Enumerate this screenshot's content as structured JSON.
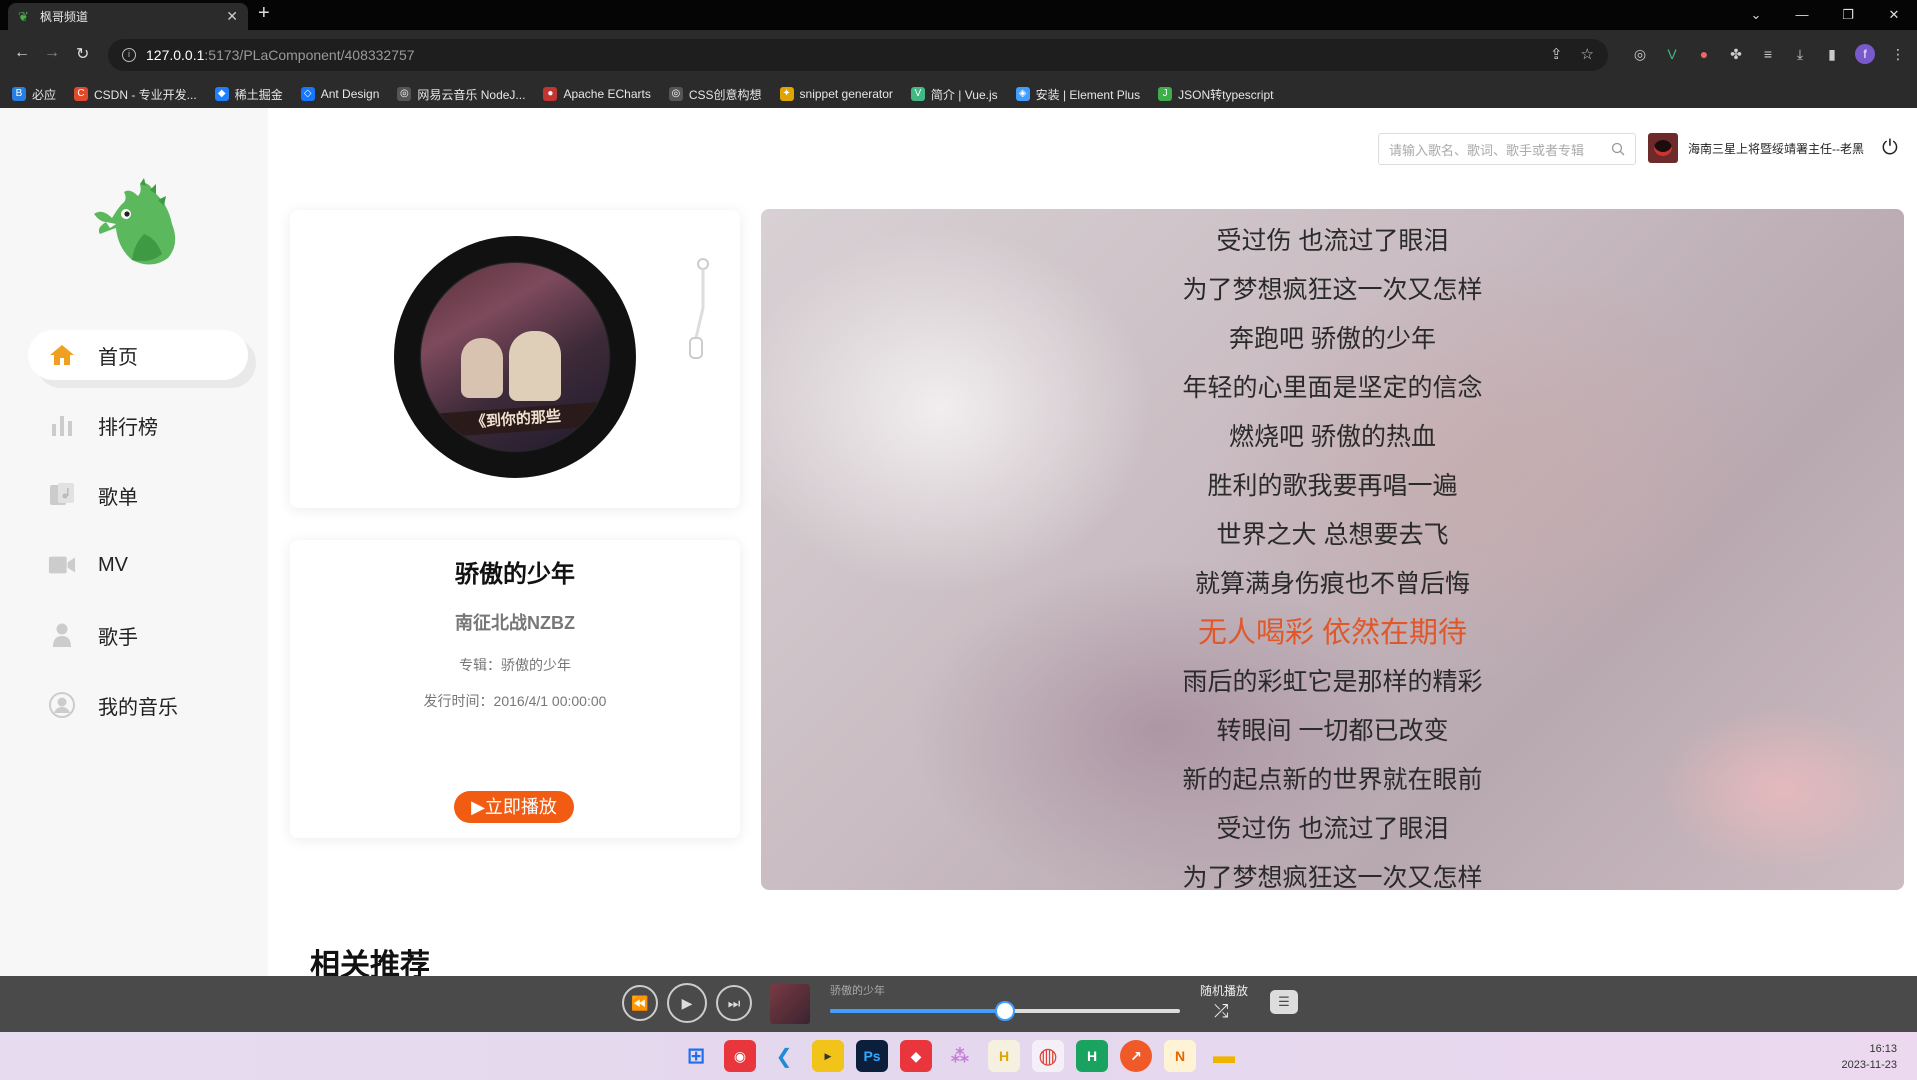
{
  "browser": {
    "tab_title": "枫哥频道",
    "url_host": "127.0.0.1",
    "url_rest": ":5173/PLaComponent/408332757",
    "bookmarks": [
      {
        "label": "必应",
        "color": "#2a7de1",
        "icon": "B"
      },
      {
        "label": "CSDN - 专业开发...",
        "color": "#e04a2a",
        "icon": "C"
      },
      {
        "label": "稀土掘金",
        "color": "#1e80ff",
        "icon": "◆"
      },
      {
        "label": "Ant Design",
        "color": "#1677ff",
        "icon": "◇"
      },
      {
        "label": "网易云音乐 NodeJ...",
        "color": "#555555",
        "icon": "◎"
      },
      {
        "label": "Apache ECharts",
        "color": "#c23531",
        "icon": "●"
      },
      {
        "label": "CSS创意构想",
        "color": "#555555",
        "icon": "◎"
      },
      {
        "label": "snippet generator",
        "color": "#e0a400",
        "icon": "✦"
      },
      {
        "label": "简介 | Vue.js",
        "color": "#42b883",
        "icon": "V"
      },
      {
        "label": "安装 | Element Plus",
        "color": "#409eff",
        "icon": "◈"
      },
      {
        "label": "JSON转typescript",
        "color": "#3fae4a",
        "icon": "J"
      }
    ]
  },
  "header": {
    "search_placeholder": "请输入歌名、歌词、歌手或者专辑",
    "username": "海南三星上将暨绥靖署主任--老黑"
  },
  "sidebar": {
    "items": [
      {
        "label": "首页",
        "icon": "home-icon",
        "active": true
      },
      {
        "label": "排行榜",
        "icon": "bar-chart-icon",
        "active": false
      },
      {
        "label": "歌单",
        "icon": "playlist-icon",
        "active": false
      },
      {
        "label": "MV",
        "icon": "video-icon",
        "active": false
      },
      {
        "label": "歌手",
        "icon": "person-icon",
        "active": false
      },
      {
        "label": "我的音乐",
        "icon": "user-circle-icon",
        "active": false
      }
    ]
  },
  "song": {
    "disc_banner": "《到你的那些",
    "title": "骄傲的少年",
    "artist": "南征北战NZBZ",
    "album": "专辑：骄傲的少年",
    "release": "发行时间：2016/4/1 00:00:00",
    "play_button": "立即播放"
  },
  "lyrics": {
    "current_index": 8,
    "lines": [
      "受过伤 也流过了眼泪",
      "为了梦想疯狂这一次又怎样",
      "奔跑吧 骄傲的少年",
      "年轻的心里面是坚定的信念",
      "燃烧吧 骄傲的热血",
      "胜利的歌我要再唱一遍",
      "世界之大 总想要去飞",
      "就算满身伤痕也不曾后悔",
      "无人喝彩 依然在期待",
      "雨后的彩虹它是那样的精彩",
      "转眼间 一切都已改变",
      "新的起点新的世界就在眼前",
      "受过伤 也流过了眼泪",
      "为了梦想疯狂这一次又怎样"
    ]
  },
  "recommend_title": "相关推荐",
  "player": {
    "song_name": "骄傲的少年",
    "progress": 0.5,
    "mode_label": "随机播放"
  },
  "taskbar": {
    "time": "16:13",
    "date": "2023-11-23"
  },
  "colors": {
    "accent": "#f25b12",
    "current_lyric": "#e0582a",
    "progress": "#409eff",
    "home_icon": "#f0a020"
  }
}
